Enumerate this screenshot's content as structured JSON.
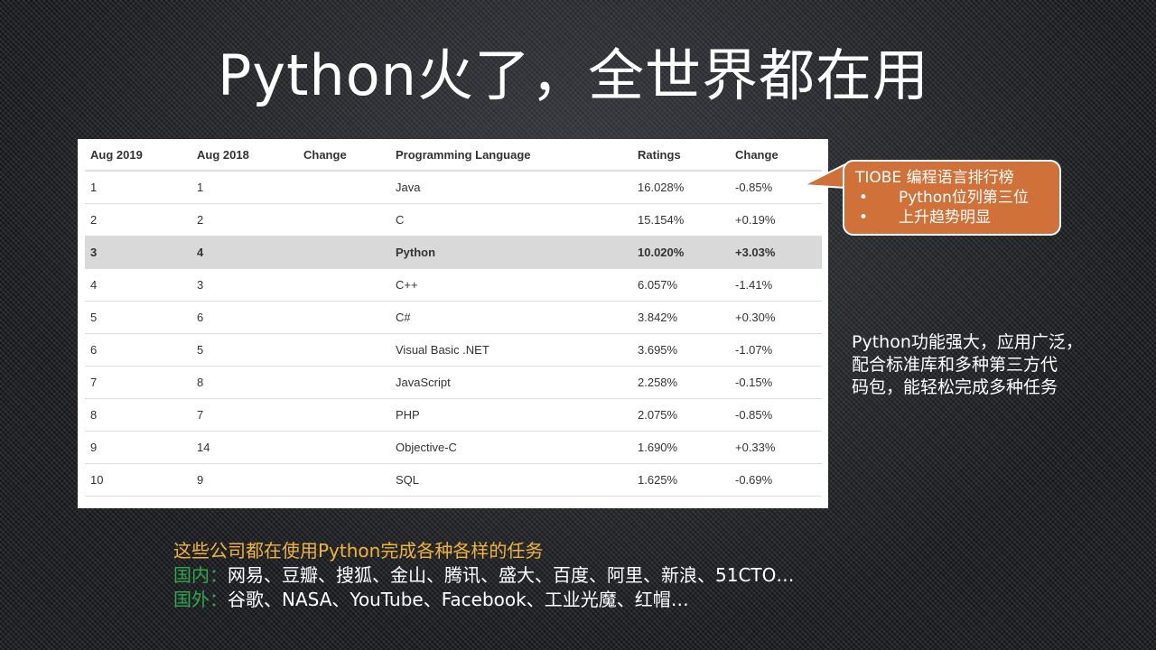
{
  "title": "Python火了，全世界都在用",
  "table": {
    "headers": [
      "Aug 2019",
      "Aug 2018",
      "Change",
      "Programming Language",
      "Ratings",
      "Change"
    ],
    "rows": [
      {
        "aug2019": "1",
        "aug2018": "1",
        "change": "",
        "language": "Java",
        "ratings": "16.028%",
        "ratings_change": "-0.85%"
      },
      {
        "aug2019": "2",
        "aug2018": "2",
        "change": "",
        "language": "C",
        "ratings": "15.154%",
        "ratings_change": "+0.19%"
      },
      {
        "aug2019": "3",
        "aug2018": "4",
        "change": "",
        "language": "Python",
        "ratings": "10.020%",
        "ratings_change": "+3.03%"
      },
      {
        "aug2019": "4",
        "aug2018": "3",
        "change": "",
        "language": "C++",
        "ratings": "6.057%",
        "ratings_change": "-1.41%"
      },
      {
        "aug2019": "5",
        "aug2018": "6",
        "change": "",
        "language": "C#",
        "ratings": "3.842%",
        "ratings_change": "+0.30%"
      },
      {
        "aug2019": "6",
        "aug2018": "5",
        "change": "",
        "language": "Visual Basic .NET",
        "ratings": "3.695%",
        "ratings_change": "-1.07%"
      },
      {
        "aug2019": "7",
        "aug2018": "8",
        "change": "",
        "language": "JavaScript",
        "ratings": "2.258%",
        "ratings_change": "-0.15%"
      },
      {
        "aug2019": "8",
        "aug2018": "7",
        "change": "",
        "language": "PHP",
        "ratings": "2.075%",
        "ratings_change": "-0.85%"
      },
      {
        "aug2019": "9",
        "aug2018": "14",
        "change": "",
        "language": "Objective-C",
        "ratings": "1.690%",
        "ratings_change": "+0.33%"
      },
      {
        "aug2019": "10",
        "aug2018": "9",
        "change": "",
        "language": "SQL",
        "ratings": "1.625%",
        "ratings_change": "-0.69%"
      }
    ],
    "highlight_row": 3
  },
  "callout": {
    "title": "TIOBE 编程语言排行榜",
    "bullet_symbol": "•",
    "items": [
      "Python位列第三位",
      "上升趋势明显"
    ]
  },
  "side_text": {
    "lines": [
      "Python功能强大，应用广泛，",
      "配合标准库和多种第三方代",
      "码包，能轻松完成多种任务"
    ]
  },
  "companies": {
    "heading": "这些公司都在使用Python完成各种各样的任务",
    "domestic_label": "国内：",
    "domestic_value": "网易、豆瓣、搜狐、金山、腾讯、盛大、百度、阿里、新浪、51CTO…",
    "foreign_label": "国外：",
    "foreign_value": "谷歌、NASA、YouTube、Facebook、工业光魔、红帽…"
  },
  "colors": {
    "callout_bg": "#d0713a",
    "heading_gold": "#f0b43a",
    "label_green": "#2fa84f",
    "highlight_row_bg": "#d9d9d9"
  }
}
